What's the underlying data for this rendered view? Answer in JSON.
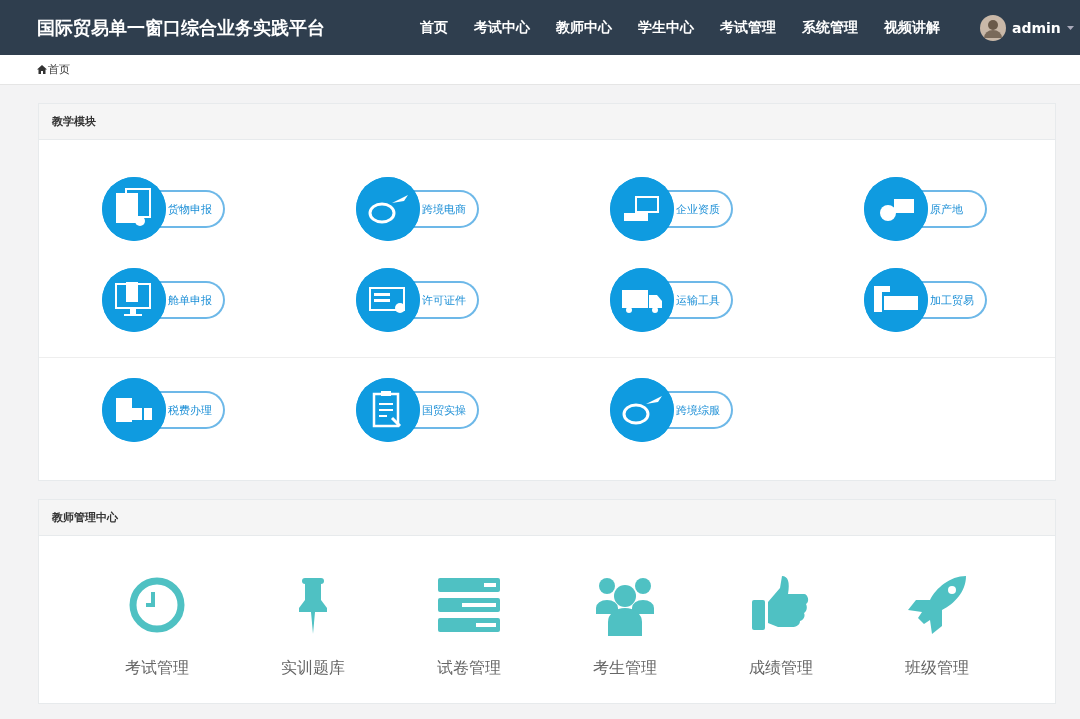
{
  "navbar": {
    "title": "国际贸易单一窗口综合业务实践平台",
    "menu": [
      "首页",
      "考试中心",
      "教师中心",
      "学生中心",
      "考试管理",
      "系统管理",
      "视频讲解"
    ],
    "user": "admin"
  },
  "breadcrumb": "首页",
  "teaching_modules": {
    "title": "教学模块",
    "groups": [
      {
        "items": [
          "货物申报",
          "跨境电商",
          "企业资质",
          "原产地",
          "舱单申报",
          "许可证件",
          "运输工具",
          "加工贸易"
        ]
      },
      {
        "items": [
          "税费办理",
          "国贸实操",
          "跨境综服"
        ]
      }
    ]
  },
  "teacher_center": {
    "title": "教师管理中心",
    "items": [
      "考试管理",
      "实训题库",
      "试卷管理",
      "考生管理",
      "成绩管理",
      "班级管理"
    ]
  }
}
